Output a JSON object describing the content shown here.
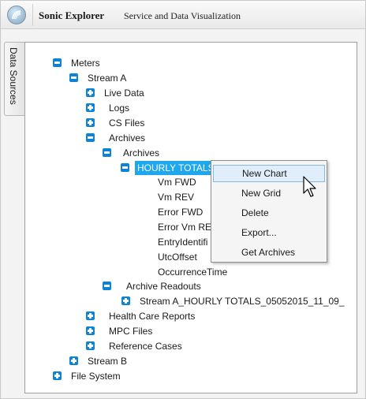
{
  "header": {
    "app_name": "Sonic Explorer",
    "subtitle": "Service and Data Visualization"
  },
  "side_tab": {
    "label": "Data Sources"
  },
  "tree": {
    "meters": "Meters",
    "stream_a": "Stream A",
    "live_data": "Live Data",
    "logs": "Logs",
    "cs_files": "CS Files",
    "archives": "Archives",
    "archives_sub": "Archives",
    "hourly_totals": "HOURLY TOTALS",
    "children": [
      "Vm FWD",
      "Vm REV",
      "Error FWD",
      "Error Vm RE",
      "EntryIdentifi",
      "UtcOffset",
      "OccurrenceTime"
    ],
    "archive_readouts": "Archive Readouts",
    "readout_file": "Stream A_HOURLY TOTALS_05052015_11_09_",
    "health_care": "Health Care Reports",
    "mpc_files": "MPC Files",
    "reference_cases": "Reference Cases",
    "stream_b": "Stream B",
    "file_system": "File System"
  },
  "context_menu": {
    "items": [
      "New Chart",
      "New Grid",
      "Delete",
      "Export...",
      "Get Archives"
    ],
    "hovered": "New Chart"
  },
  "colors": {
    "toggle": "#0a83d8",
    "selection": "#1ea7ea",
    "menu_hover": "#dfeefa"
  }
}
